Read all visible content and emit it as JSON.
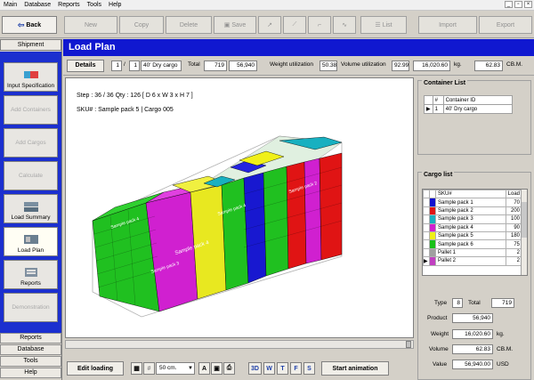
{
  "menu": [
    "Main",
    "Database",
    "Reports",
    "Tools",
    "Help"
  ],
  "toolbar": {
    "back": "Back",
    "buttons": [
      "New",
      "Copy",
      "Delete",
      "Save",
      "List",
      "Import",
      "Export"
    ]
  },
  "nav": {
    "header": "Shipment",
    "items": [
      {
        "label": "Input Specification",
        "enabled": true
      },
      {
        "label": "Add Containers",
        "enabled": false
      },
      {
        "label": "Add Cargos",
        "enabled": false
      },
      {
        "label": "Calculate",
        "enabled": false
      },
      {
        "label": "Load Summary",
        "enabled": true
      },
      {
        "label": "Load Plan",
        "enabled": true
      },
      {
        "label": "Reports",
        "enabled": true
      },
      {
        "label": "Demonstration",
        "enabled": false
      }
    ],
    "footer": [
      "Reports",
      "Database",
      "Tools",
      "Help"
    ]
  },
  "title": "Load Plan",
  "details": {
    "button": "Details",
    "index": "1",
    "count": "1",
    "container": "40' Dry cargo",
    "total_label": "Total",
    "total_qty": "719",
    "total_value": "56,940",
    "weight_label": "Weight utilization",
    "weight_util": "50.38",
    "volume_label": "Volume utilization",
    "volume_util": "92.99",
    "weight": "16,020.60",
    "weight_unit": "kg.",
    "volume": "62.83",
    "volume_unit": "CB.M."
  },
  "viewport": {
    "step_line": "Step : 36 / 36  Qty :  126  [ D 6 x W 3 x H 7 ]",
    "sku_line": "SKU# : Sample pack 5 | Cargo 005",
    "box_labels": [
      "Sample pack 4",
      "Sample pack 4",
      "Sample pack 4",
      "Sample pack 2",
      "Sample pack 3"
    ]
  },
  "bottom": {
    "edit_loading": "Edit loading",
    "zoom_value": "50 cm.",
    "view_modes": [
      "3D",
      "W",
      "T",
      "F",
      "S"
    ],
    "start_animation": "Start animation"
  },
  "container_list": {
    "title": "Container List",
    "headers": [
      "#",
      "Container ID"
    ],
    "rows": [
      {
        "num": "1",
        "id": "40' Dry cargo"
      }
    ]
  },
  "cargo_list": {
    "title": "Cargo list",
    "headers": [
      "SKU#",
      "Load"
    ],
    "rows": [
      {
        "sku": "Sample pack 1",
        "load": "70",
        "color": "#1010d0"
      },
      {
        "sku": "Sample pack 2",
        "load": "200",
        "color": "#e01414"
      },
      {
        "sku": "Sample pack 3",
        "load": "100",
        "color": "#18b0c0"
      },
      {
        "sku": "Sample pack 4",
        "load": "90",
        "color": "#d020d0"
      },
      {
        "sku": "Sample pack 5",
        "load": "180",
        "color": "#f0f018"
      },
      {
        "sku": "Sample pack 6",
        "load": "75",
        "color": "#18c018"
      },
      {
        "sku": "Pallet 1",
        "load": "2",
        "color": "#a0a0a0"
      },
      {
        "sku": "Pallet 2",
        "load": "2",
        "color": "#c040c0"
      }
    ]
  },
  "summary": {
    "type_label": "Type",
    "type": "8",
    "total_label": "Total",
    "total": "719",
    "product_label": "Product",
    "product": "56,940",
    "weight_label": "Weight",
    "weight": "16,020.60",
    "weight_unit": "kg.",
    "volume_label": "Volume",
    "volume": "62.83",
    "volume_unit": "CB.M.",
    "value_label": "Value",
    "value": "56,940.00",
    "value_unit": "USD"
  },
  "colors": {
    "title_bar": "#1018d0",
    "nav_panel": "#1b2fcf"
  }
}
